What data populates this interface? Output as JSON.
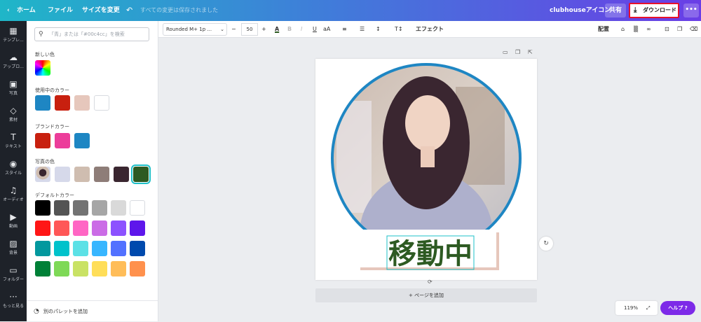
{
  "topbar": {
    "back_label": "ホーム",
    "file_label": "ファイル",
    "resize_label": "サイズを変更",
    "saved_status": "すべての変更は保存されました",
    "doc_title": "clubhouseアイコン",
    "share_label": "共有",
    "download_label": "ダウンロード",
    "more_label": "•••"
  },
  "left_rail": [
    {
      "label": "テンプレ...",
      "icon": "template-icon"
    },
    {
      "label": "アップロ...",
      "icon": "upload-icon"
    },
    {
      "label": "写真",
      "icon": "photo-icon"
    },
    {
      "label": "素材",
      "icon": "elements-icon"
    },
    {
      "label": "テキスト",
      "icon": "text-icon"
    },
    {
      "label": "スタイル",
      "icon": "style-icon"
    },
    {
      "label": "オーディオ",
      "icon": "audio-icon"
    },
    {
      "label": "動画",
      "icon": "video-icon"
    },
    {
      "label": "背景",
      "icon": "background-icon"
    },
    {
      "label": "フォルダー",
      "icon": "folder-icon"
    },
    {
      "label": "もっと見る",
      "icon": "more-icon"
    }
  ],
  "color_panel": {
    "search_placeholder": "「青」または「#00c4cc」を検索",
    "new_color_label": "新しい色",
    "in_use_label": "使用中のカラー",
    "in_use_colors": [
      "#1e86c3",
      "#c8200f",
      "#e6c7bc",
      "#ffffff"
    ],
    "brand_label": "ブランドカラー",
    "brand_colors": [
      "#c8200f",
      "#ec3d9a",
      "#1e86c3"
    ],
    "photo_label": "写真の色",
    "photo_colors": [
      "#d6d9ea",
      "#cfbdb0",
      "#8e7d78",
      "#3a2630",
      "#2d5a22"
    ],
    "default_label": "デフォルトカラー",
    "default_colors": [
      [
        "#000000",
        "#545454",
        "#737373",
        "#a6a6a6",
        "#d9d9d9",
        "#ffffff"
      ],
      [
        "#ff1616",
        "#ff5757",
        "#ff66c4",
        "#cb6ce6",
        "#8c52ff",
        "#5e17eb"
      ],
      [
        "#03989e",
        "#00c2cb",
        "#5ce1e6",
        "#38b6ff",
        "#5271ff",
        "#004aad"
      ],
      [
        "#008037",
        "#7ed957",
        "#c9e265",
        "#ffde59",
        "#ffbd59",
        "#ff914d"
      ]
    ],
    "add_palette_label": "別のパレットを追加"
  },
  "toolbar": {
    "font_name": "Rounded M+ 1p ...",
    "font_size": "50",
    "minus": "−",
    "plus": "+",
    "effects_label": "エフェクト",
    "arrange_label": "配置"
  },
  "canvas": {
    "overlay_text": "移動中",
    "ring_color": "#1e86c3",
    "text_color": "#2d5a22",
    "add_page_label": "+ ページを追加"
  },
  "footer": {
    "zoom_level": "119%",
    "help_label": "ヘルプ ?"
  }
}
